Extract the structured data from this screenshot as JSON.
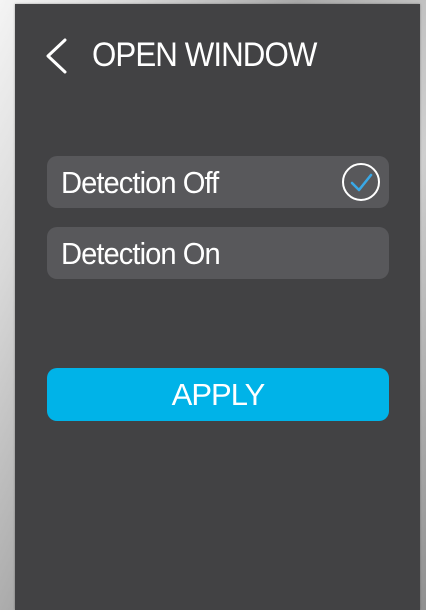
{
  "header": {
    "title": "OPEN WINDOW",
    "back_icon": "chevron-left-icon"
  },
  "options": [
    {
      "label": "Detection Off",
      "selected": true,
      "selected_icon": "check-circle-icon"
    },
    {
      "label": "Detection On",
      "selected": false
    }
  ],
  "apply": {
    "label": "APPLY"
  },
  "colors": {
    "panel": "#424244",
    "option": "#58585b",
    "accent": "#00b3e8",
    "check": "#3aa8e6",
    "text": "#ffffff"
  }
}
